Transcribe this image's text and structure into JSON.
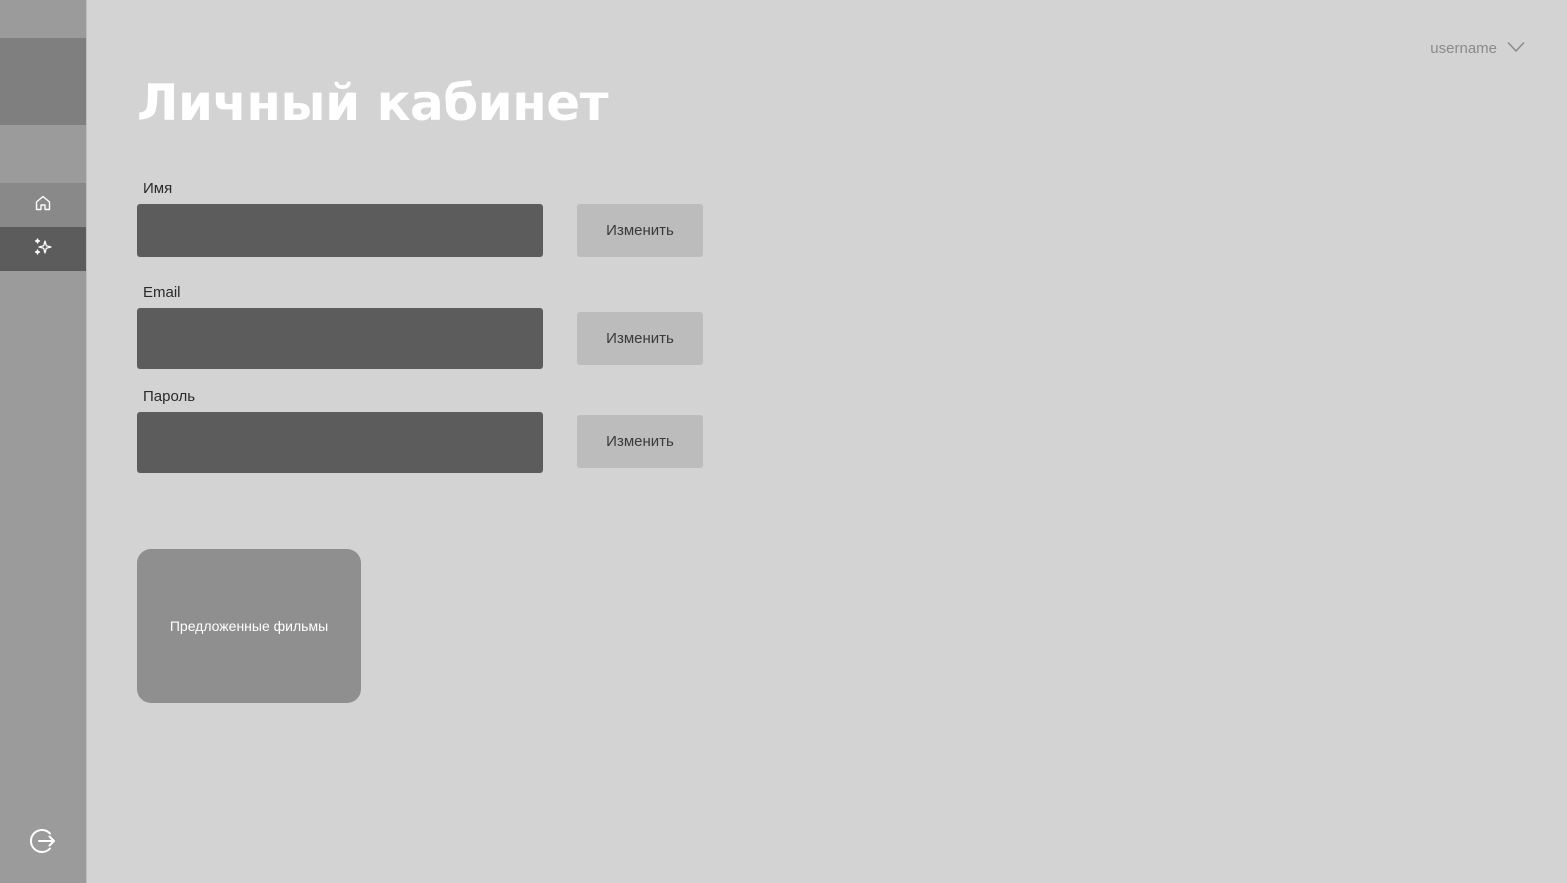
{
  "sidebar": {
    "nav": [
      {
        "id": "home",
        "icon": "home-icon"
      },
      {
        "id": "recommendations",
        "icon": "sparkles-icon"
      }
    ],
    "logout_icon": "logout-icon"
  },
  "header": {
    "username": "username",
    "dropdown_icon": "chevron-down-icon"
  },
  "main": {
    "title": "Личный кабинет",
    "fields": [
      {
        "label": "Имя",
        "value": "",
        "button_label": "Изменить"
      },
      {
        "label": "Email",
        "value": "",
        "button_label": "Изменить"
      },
      {
        "label": "Пароль",
        "value": "",
        "button_label": "Изменить"
      }
    ],
    "suggested_card_label": "Предложенные фильмы"
  },
  "colors": {
    "background": "#d3d3d3",
    "sidebar": "#9b9b9b",
    "input": "#5c5c5c",
    "button": "#bcbcbc",
    "card": "#8f8f8f",
    "active_nav": "#5c5c5c",
    "title": "#ffffff"
  }
}
